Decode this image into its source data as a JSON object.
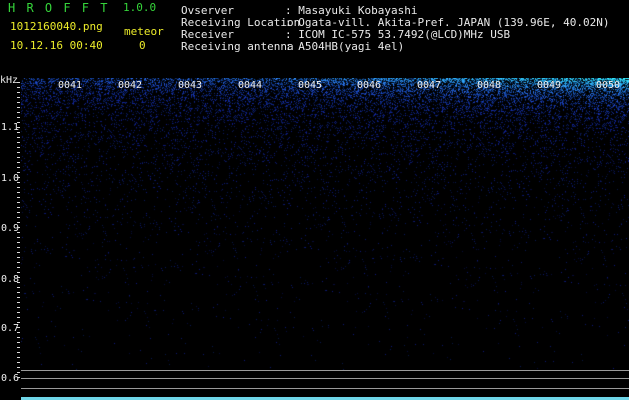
{
  "app": {
    "name": "H R O F F T",
    "version": "1.0.0"
  },
  "file": {
    "name": "1012160040.png",
    "datetime": "10.12.16 00:40"
  },
  "meteor": {
    "label": "meteor",
    "count": "0"
  },
  "info": [
    {
      "label": "Ovserver",
      "value": ": Masayuki Kobayashi"
    },
    {
      "label": "Receiving Location",
      "value": ": Ogata-vill. Akita-Pref. JAPAN (139.96E, 40.02N)"
    },
    {
      "label": "Receiver",
      "value": ": ICOM IC-575 53.7492(@LCD)MHz USB"
    },
    {
      "label": "Receiving antenna",
      "value": ": A504HB(yagi 4el)"
    }
  ],
  "axis": {
    "unit": "kHz",
    "y_labels": [
      "1.1",
      "1.0",
      "0.9",
      "0.8",
      "0.7",
      "0.6"
    ],
    "time_labels": [
      "0041",
      "0042",
      "0043",
      "0044",
      "0045",
      "0046",
      "0047",
      "0048",
      "0049",
      "0050"
    ]
  },
  "colors": {
    "text_green": "#35d43a",
    "text_yellow": "#ecec2a",
    "signal_blue": "#2f6bff",
    "background": "#000000"
  }
}
